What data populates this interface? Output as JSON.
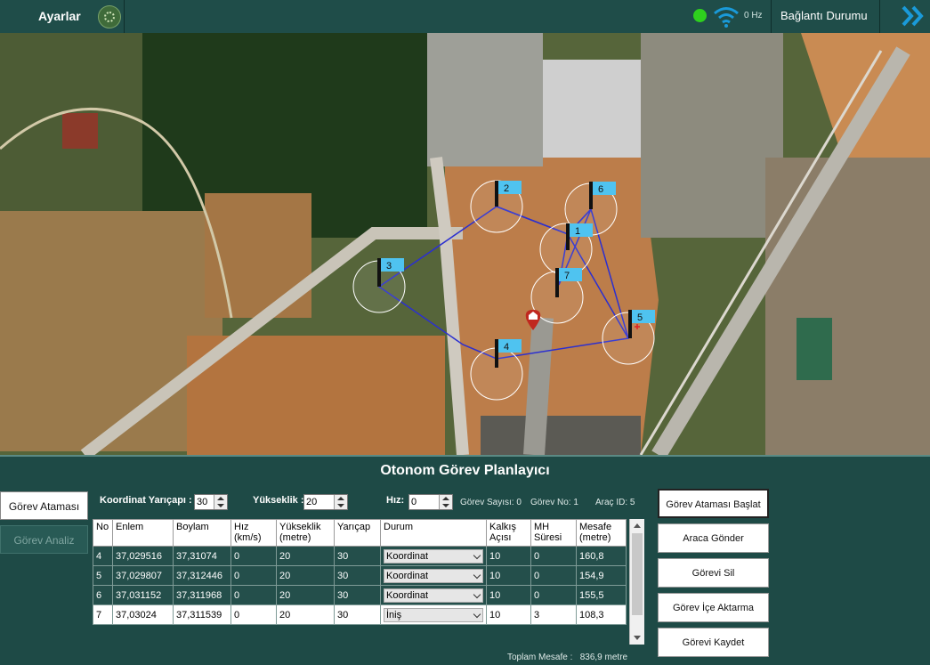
{
  "topbar": {
    "settings_label": "Ayarlar",
    "frequency": "0 Hz",
    "connection_label": "Bağlantı Durumu",
    "status_color": "#2ed01e",
    "wifi_color": "#1a9ad9"
  },
  "map": {
    "waypoints": [
      {
        "label": "2"
      },
      {
        "label": "6"
      },
      {
        "label": "1"
      },
      {
        "label": "3"
      },
      {
        "label": "7"
      },
      {
        "label": "5"
      },
      {
        "label": "4"
      }
    ],
    "route_color": "#2b2fd0",
    "home_icon": "home-marker-icon"
  },
  "panel": {
    "title": "Otonom Görev Planlayıcı",
    "side_tabs": [
      {
        "label": "Görev Ataması"
      },
      {
        "label": "Görev Analiz"
      }
    ],
    "params": {
      "radius_label": "Koordinat Yarıçapı :",
      "radius_value": "30",
      "altitude_label": "Yükseklik :",
      "altitude_value": "20",
      "speed_label": "Hız:",
      "speed_value": "0",
      "task_count": "Görev Sayısı: 0",
      "task_no": "Görev No: 1",
      "vehicle_id": "Araç ID: 5"
    },
    "table": {
      "headers": [
        "No",
        "Enlem",
        "Boylam",
        "Hız (km/s)",
        "Yükseklik (metre)",
        "Yarıçap",
        "Durum",
        "Kalkış Açısı",
        "MH Süresi",
        "Mesafe (metre)"
      ],
      "rows": [
        {
          "no": "4",
          "lat": "37,029516",
          "lon": "37,31074",
          "speed": "0",
          "alt": "20",
          "radius": "30",
          "status": "Koordinat",
          "takeoff": "10",
          "mh": "0",
          "distance": "160,8"
        },
        {
          "no": "5",
          "lat": "37,029807",
          "lon": "37,312446",
          "speed": "0",
          "alt": "20",
          "radius": "30",
          "status": "Koordinat",
          "takeoff": "10",
          "mh": "0",
          "distance": "154,9"
        },
        {
          "no": "6",
          "lat": "37,031152",
          "lon": "37,311968",
          "speed": "0",
          "alt": "20",
          "radius": "30",
          "status": "Koordinat",
          "takeoff": "10",
          "mh": "0",
          "distance": "155,5"
        },
        {
          "no": "7",
          "lat": "37,03024",
          "lon": "37,311539",
          "speed": "0",
          "alt": "20",
          "radius": "30",
          "status": "İniş",
          "takeoff": "10",
          "mh": "3",
          "distance": "108,3"
        }
      ]
    },
    "total_label": "Toplam Mesafe :",
    "total_value": "836,9 metre",
    "actions": [
      {
        "label": "Görev Ataması Başlat"
      },
      {
        "label": "Araca Gönder"
      },
      {
        "label": "Görevi Sil"
      },
      {
        "label": "Görev İçe Aktarma"
      },
      {
        "label": "Görevi Kaydet"
      }
    ]
  }
}
